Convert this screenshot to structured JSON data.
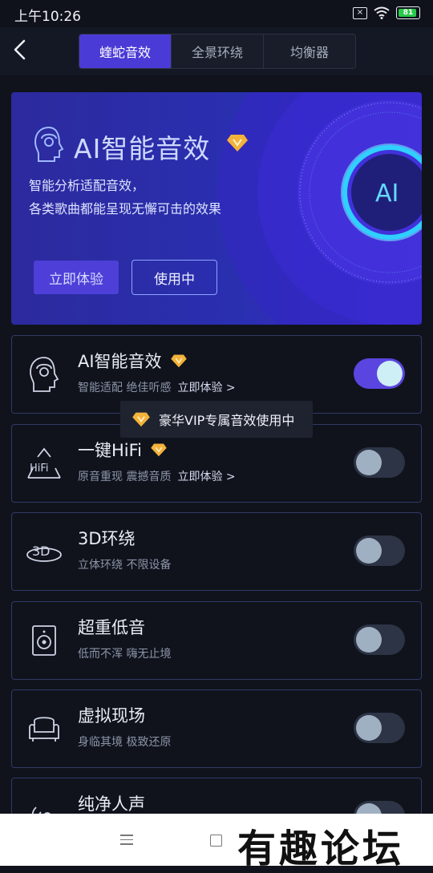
{
  "status": {
    "time": "上午10:26",
    "battery": "81"
  },
  "nav": {
    "tabs": [
      "蝰蛇音效",
      "全景环绕",
      "均衡器"
    ],
    "active_tab": 0
  },
  "banner": {
    "title": "AI智能音效",
    "desc_line1": "智能分析适配音效，",
    "desc_line2": "各类歌曲都能呈现无懈可击的效果",
    "btn_try": "立即体验",
    "btn_in_use": "使用中",
    "art_label": "AI"
  },
  "effects": [
    {
      "title": "AI智能音效",
      "vip": true,
      "subtitle": "智能适配 绝佳听感",
      "link": "立即体验 >",
      "enabled": true,
      "icon": "ai-head-icon"
    },
    {
      "title": "一键HiFi",
      "vip": true,
      "subtitle": "原音重现 震撼音质",
      "link": "立即体验 >",
      "enabled": false,
      "icon": "hifi-icon"
    },
    {
      "title": "3D环绕",
      "vip": false,
      "subtitle": "立体环绕 不限设备",
      "link": "",
      "enabled": false,
      "icon": "3d-icon"
    },
    {
      "title": "超重低音",
      "vip": false,
      "subtitle": "低而不浑 嗨无止境",
      "link": "",
      "enabled": false,
      "icon": "speaker-icon"
    },
    {
      "title": "虚拟现场",
      "vip": false,
      "subtitle": "身临其境 极致还原",
      "link": "",
      "enabled": false,
      "icon": "sofa-icon"
    },
    {
      "title": "纯净人声",
      "vip": false,
      "subtitle": "",
      "link": "",
      "enabled": false,
      "icon": "voice-icon"
    }
  ],
  "tooltip": {
    "text": "豪华VIP专属音效使用中"
  },
  "watermark": "有趣论坛",
  "colors": {
    "accent": "#4b3bd6",
    "toggle_on": "#5b45e0",
    "card_border": "#2f3a66"
  }
}
